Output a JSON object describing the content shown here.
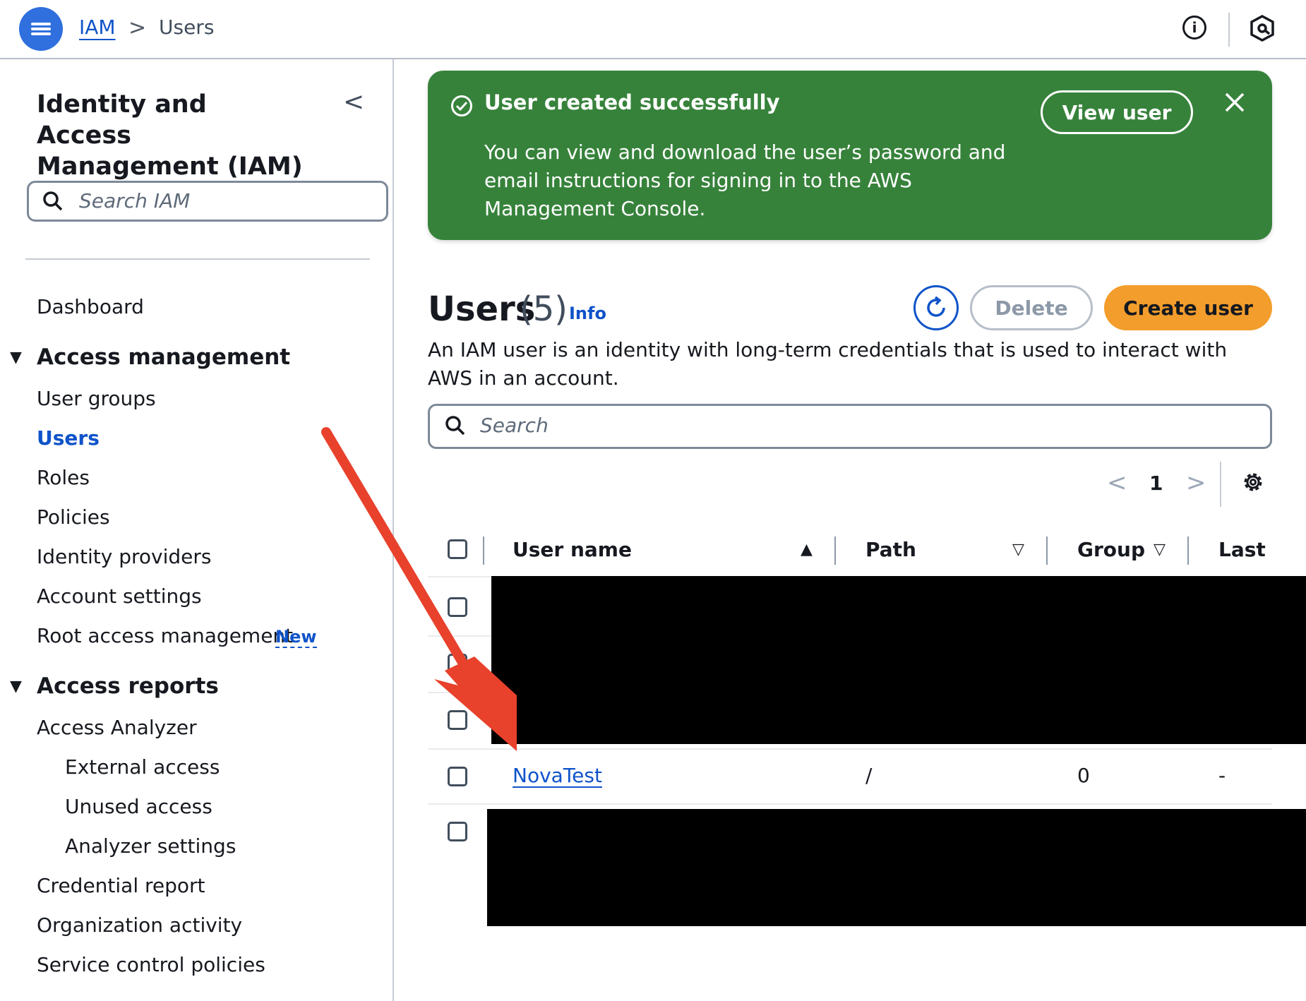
{
  "header": {
    "breadcrumb_service": "IAM",
    "breadcrumb_separator": ">",
    "breadcrumb_current": "Users",
    "info_icon_label": "i"
  },
  "sidebar": {
    "title": "Identity and Access Management (IAM)",
    "collapse_label": "<",
    "search_placeholder": "Search IAM",
    "dashboard": "Dashboard",
    "section_access_management": "Access management",
    "access_management_items": [
      "User groups",
      "Users",
      "Roles",
      "Policies",
      "Identity providers",
      "Account settings",
      "Root access management"
    ],
    "new_badge": "New",
    "section_access_reports": "Access reports",
    "access_reports_items": [
      "Access Analyzer",
      "External access",
      "Unused access",
      "Analyzer settings",
      "Credential report",
      "Organization activity",
      "Service control policies"
    ]
  },
  "flash": {
    "title": "User created successfully",
    "body": "You can view and download the user’s password and email instructions for signing in to the AWS Management Console.",
    "view_user_label": "View user",
    "close_label": "✕"
  },
  "users": {
    "title": "Users",
    "count": "(5)",
    "info_label": "Info",
    "delete_label": "Delete",
    "create_label": "Create user",
    "description": "An IAM user is an identity with long-term credentials that is used to interact with AWS in an account.",
    "search_placeholder": "Search",
    "page_prev": "<",
    "page_number": "1",
    "page_next": ">"
  },
  "table": {
    "columns": [
      "User name",
      "Path",
      "Groups",
      "Last a"
    ],
    "sort_asc": "▲",
    "sort_desc": "▽",
    "visible_row": {
      "user_name": "NovaTest",
      "path": "/",
      "groups": "0",
      "last_activity": "-"
    }
  },
  "colors": {
    "accent_blue": "#0f53c9",
    "flash_green": "#37823b",
    "create_orange": "#f39d2c",
    "annotation_arrow": "#e8412c"
  }
}
